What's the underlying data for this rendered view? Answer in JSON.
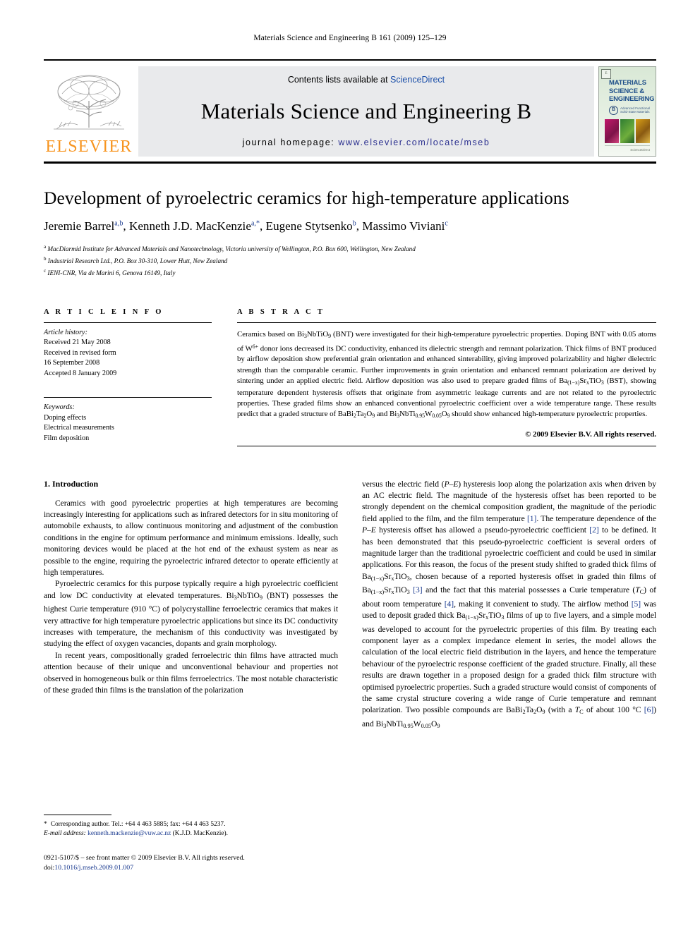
{
  "running_head": "Materials Science and Engineering B 161 (2009) 125–129",
  "masthead": {
    "publisher_name": "ELSEVIER",
    "contents_prefix": "Contents lists available at ",
    "contents_link": "ScienceDirect",
    "journal_title": "Materials Science and Engineering B",
    "homepage_prefix": "journal homepage: ",
    "homepage_url": "www.elsevier.com/locate/mseb",
    "cover": {
      "title_line1": "MATERIALS",
      "title_line2": "SCIENCE &",
      "title_line3": "ENGINEERING",
      "badge_letter": "B",
      "badge_text_line1": "Advanced Functional",
      "badge_text_line2": "Solid-State Materials",
      "footer_text": "ScienceDirect"
    }
  },
  "article": {
    "title": "Development of pyroelectric ceramics for high-temperature applications",
    "authors": [
      {
        "name": "Jeremie Barrel",
        "marks": "a,b"
      },
      {
        "name": "Kenneth J.D. MacKenzie",
        "marks": "a,*"
      },
      {
        "name": "Eugene Stytsenko",
        "marks": "b"
      },
      {
        "name": "Massimo Viviani",
        "marks": "c"
      }
    ],
    "affiliations": [
      {
        "mark": "a",
        "text": "MacDiarmid Institute for Advanced Materials and Nanotechnology, Victoria university of Wellington, P.O. Box 600, Wellington, New Zealand"
      },
      {
        "mark": "b",
        "text": "Industrial Research Ltd., P.O. Box 30-310, Lower Hutt, New Zealand"
      },
      {
        "mark": "c",
        "text": "IENI-CNR, Via de Marini 6, Genova 16149, Italy"
      }
    ]
  },
  "article_info": {
    "label": "A R T I C L E    I N F O",
    "history_header": "Article history:",
    "history_lines": [
      "Received 21 May 2008",
      "Received in revised form",
      "16 September 2008",
      "Accepted 8 January 2009"
    ],
    "keywords_header": "Keywords:",
    "keywords": [
      "Doping effects",
      "Electrical measurements",
      "Film deposition"
    ]
  },
  "abstract": {
    "label": "A B S T R A C T",
    "copyright": "© 2009 Elsevier B.V. All rights reserved."
  },
  "body": {
    "section1_heading": "1.  Introduction"
  },
  "footnotes": {
    "corresponding": "Corresponding author. Tel.: +64 4 463 5885; fax: +64 4 463 5237.",
    "email_label": "E-mail address:",
    "email": "kenneth.mackenzie@vuw.ac.nz",
    "email_owner": "(K.J.D. MacKenzie).",
    "issn_line": "0921-5107/$ – see front matter © 2009 Elsevier B.V. All rights reserved.",
    "doi_label": "doi:",
    "doi_value": "10.1016/j.mseb.2009.01.007"
  },
  "colors": {
    "link": "#1a3a8f",
    "elsevier_orange": "#F7941E",
    "band_grey": "#e9eaec"
  }
}
